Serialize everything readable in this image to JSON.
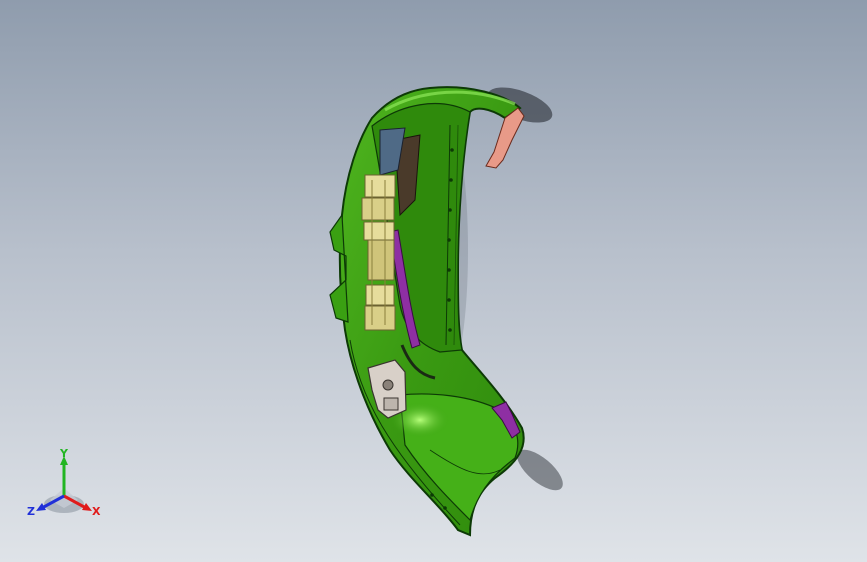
{
  "viewport": {
    "background_top": "#8f9cad",
    "background_bottom": "#dfe3e8"
  },
  "model": {
    "shell_color": "#3aa012",
    "shell_highlight": "#7be04a",
    "shell_edge": "#0d3a06",
    "connector_color": "#e6dd9c",
    "bracket_color": "#d8d0c8",
    "clip_color_pink": "#e89a88",
    "clip_color_purple": "#8e2fa3"
  },
  "triad": {
    "x_label": "X",
    "y_label": "Y",
    "z_label": "Z",
    "x_color": "#e01b1b",
    "y_color": "#22b522",
    "z_color": "#2030d8"
  }
}
